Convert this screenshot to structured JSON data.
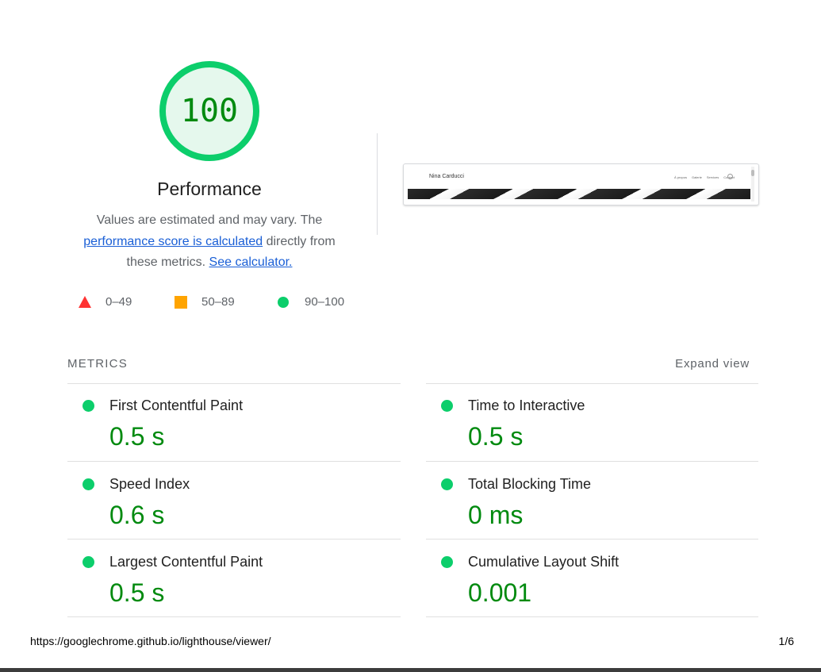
{
  "gauge": {
    "score": "100",
    "score_fraction": 1.0,
    "title": "Performance",
    "color": "#0cce6b",
    "text_color": "#018a0f",
    "fill_color": "#e5f8ed"
  },
  "description": {
    "part1": "Values are estimated and may vary. The ",
    "link1": "performance score is calculated",
    "part2": " directly from these metrics. ",
    "link2": "See calculator."
  },
  "legend": [
    {
      "icon": "red-triangle-icon",
      "label": "0–49",
      "color": "#ff3333"
    },
    {
      "icon": "orange-square-icon",
      "label": "50–89",
      "color": "#ffa400"
    },
    {
      "icon": "green-circle-icon",
      "label": "90–100",
      "color": "#0cce6b"
    }
  ],
  "screenshot": {
    "site_name": "Nina Carducci",
    "nav": [
      "À propos",
      "Galerie",
      "Services",
      "Contact"
    ],
    "nav_icon": "instagram-icon"
  },
  "metrics": {
    "heading": "METRICS",
    "expand_label": "Expand view",
    "items": [
      {
        "label": "First Contentful Paint",
        "value": "0.5 s",
        "status_icon": "green-circle-icon"
      },
      {
        "label": "Time to Interactive",
        "value": "0.5 s",
        "status_icon": "green-circle-icon"
      },
      {
        "label": "Speed Index",
        "value": "0.6 s",
        "status_icon": "green-circle-icon"
      },
      {
        "label": "Total Blocking Time",
        "value": "0 ms",
        "status_icon": "green-circle-icon"
      },
      {
        "label": "Largest Contentful Paint",
        "value": "0.5 s",
        "status_icon": "green-circle-icon"
      },
      {
        "label": "Cumulative Layout Shift",
        "value": "0.001",
        "status_icon": "green-circle-icon"
      }
    ]
  },
  "footer": {
    "url": "https://googlechrome.github.io/lighthouse/viewer/",
    "page": "1/6"
  }
}
